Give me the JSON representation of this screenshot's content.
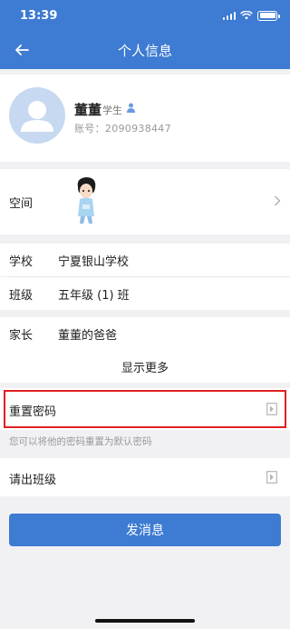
{
  "status_bar": {
    "time": "13:39",
    "battery_level": 1.0
  },
  "nav": {
    "title": "个人信息"
  },
  "profile": {
    "name": "董董",
    "role": "学生",
    "account_label": "账号：",
    "account_number": "2090938447"
  },
  "space": {
    "label": "空间"
  },
  "info_rows": [
    {
      "key": "学校",
      "value": "宁夏银山学校"
    },
    {
      "key": "班级",
      "value": "五年级 (1) 班"
    },
    {
      "key": "家长",
      "value": "董董的爸爸"
    }
  ],
  "show_more": "显示更多",
  "reset_password": {
    "label": "重置密码",
    "hint": "您可以将他的密码重置为默认密码"
  },
  "remove_from_class": {
    "label": "请出班级"
  },
  "send_message_button": "发消息",
  "colors": {
    "accent": "#3e7bd2",
    "highlight": "#e02020",
    "background": "#f1f1f4"
  }
}
